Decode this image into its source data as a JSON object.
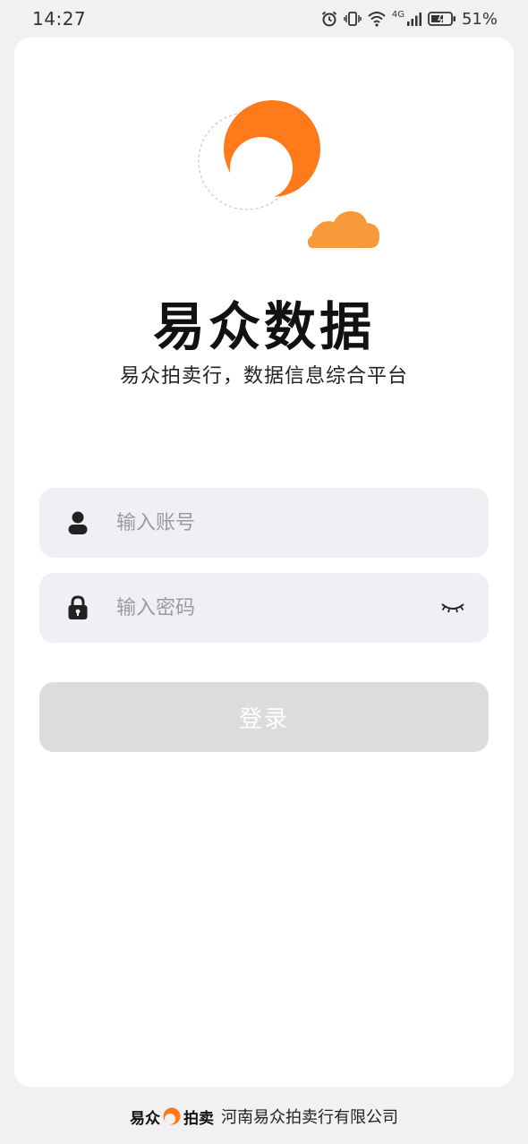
{
  "status_bar": {
    "time": "14:27",
    "battery": "51%",
    "network": "4G",
    "icons": [
      "alarm-icon",
      "vibrate-icon",
      "wifi-icon",
      "signal-icon",
      "battery-icon"
    ]
  },
  "branding": {
    "title": "易众数据",
    "subtitle": "易众拍卖行，数据信息综合平台",
    "accent_color": "#ff7a1a",
    "cloud_color": "#f7993a"
  },
  "form": {
    "username": {
      "value": "",
      "placeholder": "输入账号",
      "icon": "user-icon"
    },
    "password": {
      "value": "",
      "placeholder": "输入密码",
      "icon": "lock-icon",
      "toggle_icon": "eye-closed-icon"
    },
    "login_label": "登录",
    "login_disabled_color": "#dcdcdc"
  },
  "footer": {
    "brand_part1": "易众",
    "brand_part2": "拍卖",
    "company": "河南易众拍卖行有限公司"
  }
}
